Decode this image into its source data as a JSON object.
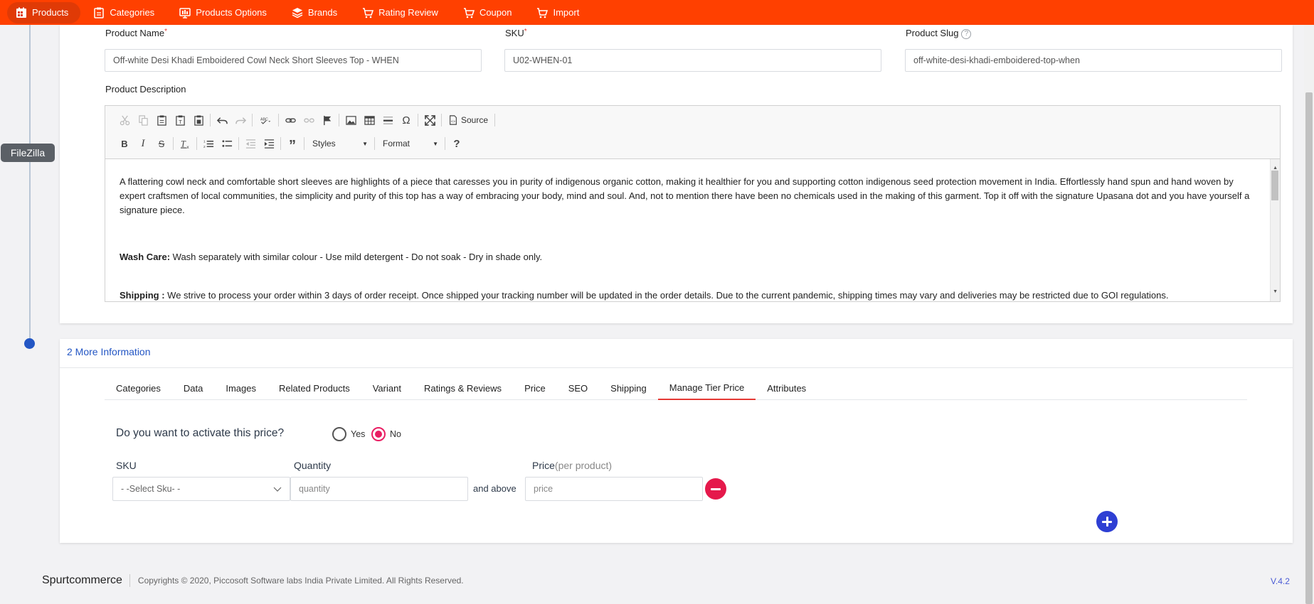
{
  "nav": {
    "items": [
      {
        "label": "Products",
        "icon": "products-icon"
      },
      {
        "label": "Categories",
        "icon": "categories-icon"
      },
      {
        "label": "Products Options",
        "icon": "product-options-icon"
      },
      {
        "label": "Brands",
        "icon": "brands-icon"
      },
      {
        "label": "Rating Review",
        "icon": "rating-review-icon"
      },
      {
        "label": "Coupon",
        "icon": "coupon-icon"
      },
      {
        "label": "Import",
        "icon": "import-icon"
      }
    ],
    "active": "Products",
    "colors": {
      "bar": "#ff4000",
      "active_pill": "#e03a06"
    }
  },
  "side": {
    "filezilla_label": "FileZilla"
  },
  "form": {
    "product_name": {
      "label": "Product Name",
      "required": "*",
      "value": "Off-white Desi Khadi Emboidered Cowl Neck Short Sleeves Top - WHEN"
    },
    "sku": {
      "label": "SKU",
      "required": "*",
      "value": "U02-WHEN-01"
    },
    "slug": {
      "label": "Product Slug",
      "help": "?",
      "value": "off-white-desi-khadi-emboidered-top-when"
    },
    "description_label": "Product Description"
  },
  "editor": {
    "toolbar": {
      "source_label": "Source",
      "styles_label": "Styles",
      "format_label": "Format",
      "help_label": "?"
    },
    "content": {
      "para1": "A flattering cowl neck and comfortable short sleeves are highlights of a piece that caresses you in purity of indigenous organic cotton, making it healthier for you and supporting cotton indigenous seed protection movement in India. Effortlessly hand spun and hand woven by expert craftsmen of local communities, the simplicity and purity of this top has a way of embracing your body, mind and soul. And, not to mention there have been no chemicals used in the making of this garment. Top it off with the signature Upasana dot and you have yourself a signature piece.",
      "wash_care_label": "Wash Care:",
      "wash_care_text": "  Wash separately with similar colour - Use mild detergent - Do not soak - Dry in shade only.",
      "shipping_label": "Shipping :",
      "shipping_text": " We strive to process your order within 3 days of order receipt. Once shipped your tracking number will be updated in the order details. Due to the current pandemic, shipping times may vary and deliveries may be restricted due to GOI regulations."
    }
  },
  "more_info": {
    "title": "2 More Information",
    "tabs": [
      "Categories",
      "Data",
      "Images",
      "Related Products",
      "Variant",
      "Ratings & Reviews",
      "Price",
      "SEO",
      "Shipping",
      "Manage Tier Price",
      "Attributes"
    ],
    "active_tab": "Manage Tier Price",
    "tier": {
      "question": "Do you want to activate this price?",
      "yes_label": "Yes",
      "no_label": "No",
      "selected": "No",
      "sku_label": "SKU",
      "quantity_label": "Quantity",
      "price_label": "Price",
      "price_sub": "(per product)",
      "sku_select_value": "- -Select Sku- -",
      "quantity_placeholder": "quantity",
      "and_above": "and above",
      "price_placeholder": "price"
    }
  },
  "footer": {
    "brand": "Spurtcommerce",
    "copyright": "Copyrights © 2020, Piccosoft Software labs India Private Limited. All Rights Reserved.",
    "version": "V.4.2"
  }
}
